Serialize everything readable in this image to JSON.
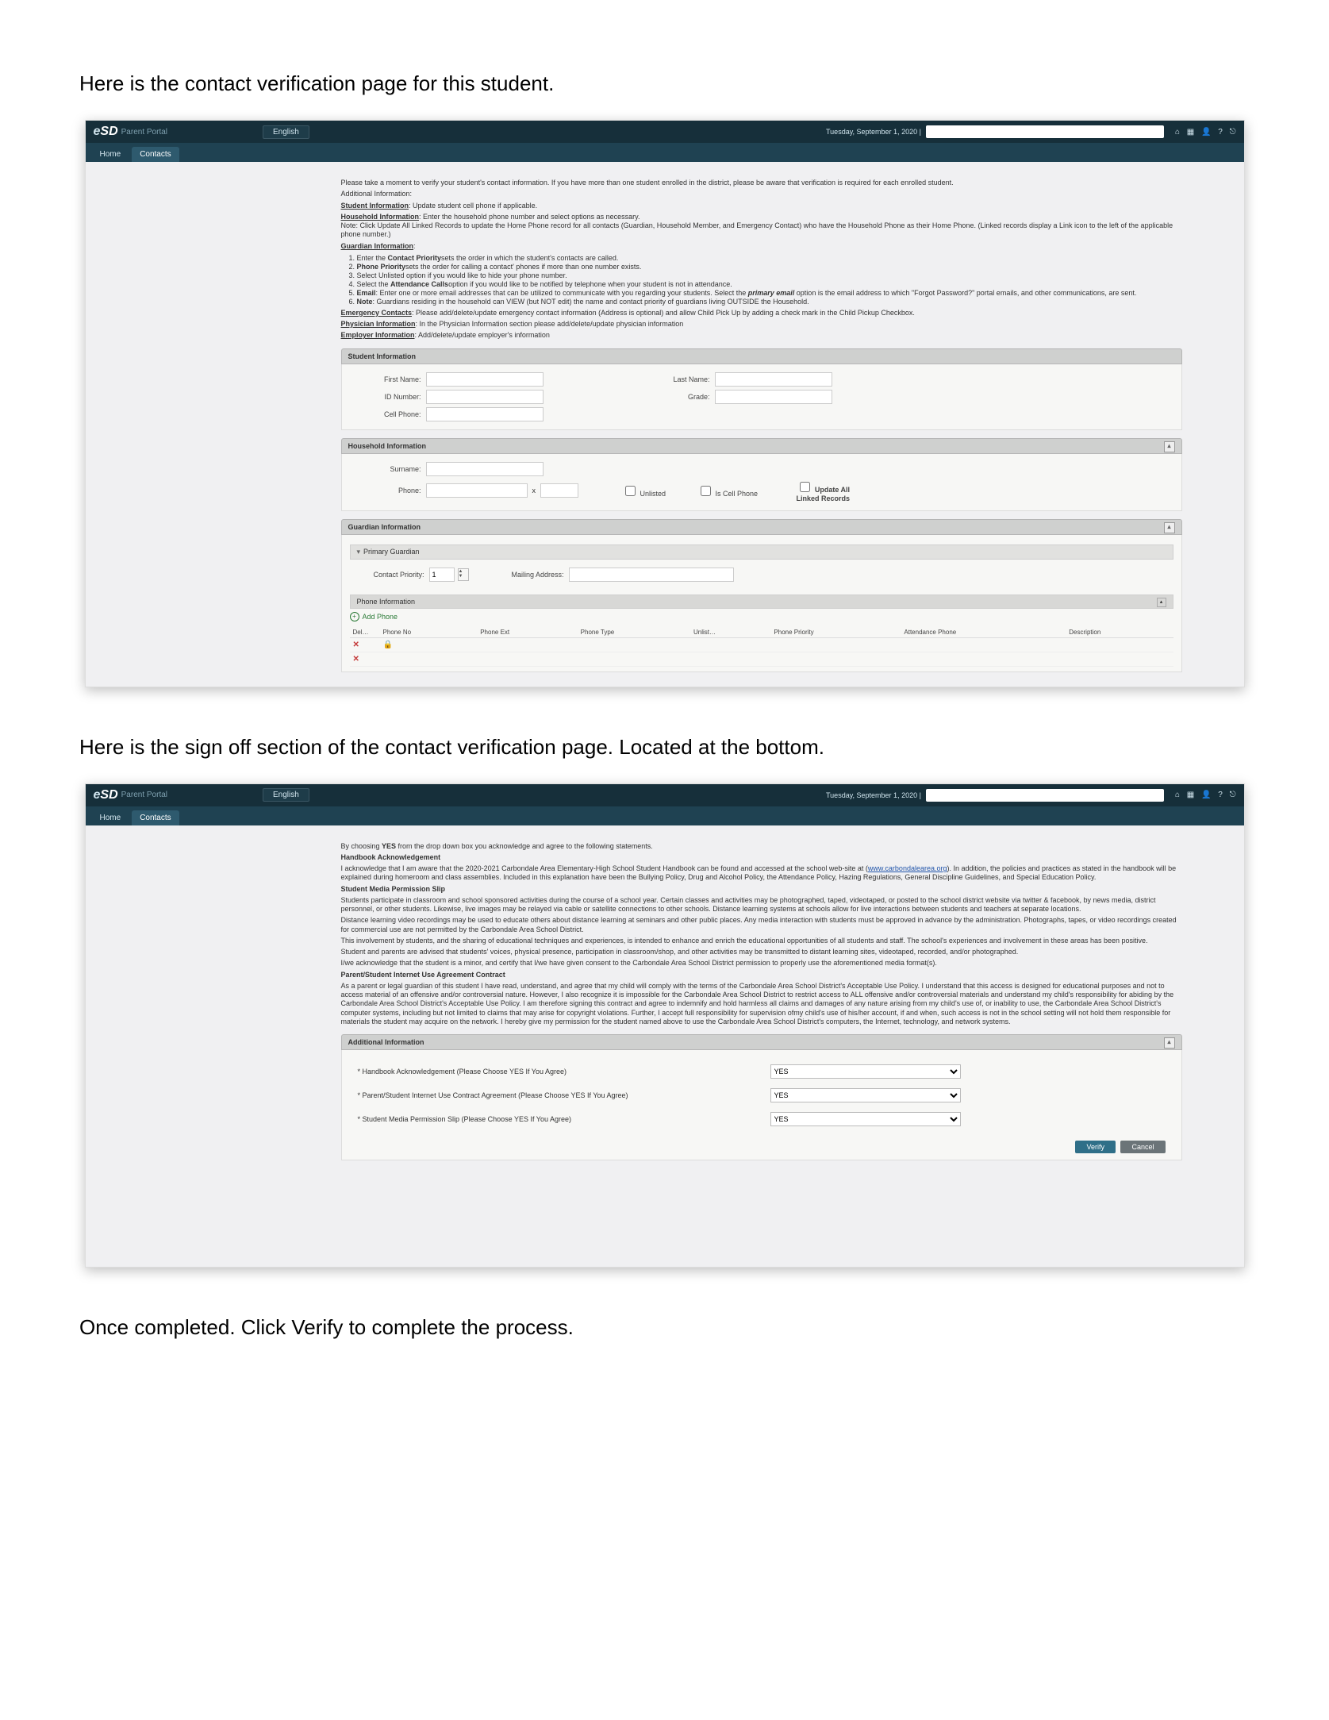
{
  "captions": {
    "c1": "Here is the contact verification page for this student.",
    "c2": "Here is the sign off section of the contact verification page. Located at the bottom.",
    "c3": "Once completed. Click Verify to complete the process."
  },
  "portal": {
    "logo_prefix": "e",
    "logo_main": "SD",
    "logo_sub": "Parent Portal",
    "language": "English",
    "date": "Tuesday, September 1, 2020  |",
    "icons": {
      "home": "⌂",
      "grid": "▦",
      "user": "👤",
      "help": "?",
      "logout": "⎋"
    },
    "menu": {
      "home": "Home",
      "contacts": "Contacts"
    }
  },
  "top": {
    "intro": "Please take a moment to verify your student's contact information.  If you have more than one student enrolled in the district, please be aware that verification is required for each enrolled student.",
    "additional": "Additional Information:",
    "student_info_label": "Student Information",
    "student_info_text": ": Update student cell phone if applicable.",
    "household_label": "Household Information",
    "household_text": ":  Enter the household phone number and select options as necessary.",
    "household_note": "Note:  Click Update All Linked Records to update the Home Phone record for all contacts (Guardian, Household Member, and Emergency Contact) who have the Household Phone as their Home Phone. (Linked records display a Link icon to the left of the applicable phone number.)",
    "guardian_label": "Guardian Information",
    "ordered": {
      "i1_a": "Enter the ",
      "i1_b": "Contact Priority",
      "i1_c": "sets the order in which the student's contacts are called.",
      "i2_a": "Phone Priority",
      "i2_b": "sets the order for calling a contact' phones if more than one number exists.",
      "i3": "Select Unlisted option if you would like to hide your phone number.",
      "i4_a": "Select the ",
      "i4_b": "Attendance Calls",
      "i4_c": "option if you would like to be notified by telephone when your student is not in attendance.",
      "i5_a": "Email",
      "i5_b": ": Enter one or more email addresses that can be utilized to communicate with you regarding your students.  Select the ",
      "i5_c": "primary email",
      "i5_d": " option is the email address to which \"Forgot Password?\" portal emails, and other communications, are sent.",
      "i6_a": "Note",
      "i6_b": ": Guardians residing in the household can VIEW (but NOT edit) the name and contact priority of guardians living OUTSIDE the Household."
    },
    "emergency_label": "Emergency Contacts",
    "emergency_text": ":  Please add/delete/update emergency contact information (Address is optional) and allow Child Pick Up by adding a check mark in the Child Pickup Checkbox.",
    "physician_label": "Physician Information",
    "physician_text": ": In the Physician Information section please add/delete/update physician information",
    "employer_label": "Employer Information",
    "employer_text": ": Add/delete/update employer's information"
  },
  "panels": {
    "student": {
      "title": "Student Information",
      "first": "First Name:",
      "last": "Last Name:",
      "id": "ID Number:",
      "grade": "Grade:",
      "cell": "Cell Phone:"
    },
    "household": {
      "title": "Household Information",
      "surname": "Surname:",
      "phone": "Phone:",
      "x": "x",
      "unlisted": "Unlisted",
      "iscell": "Is Cell Phone",
      "updateall": "Update All Linked Records"
    },
    "guardian": {
      "title": "Guardian Information",
      "primary": "Primary Guardian",
      "contact_priority": "Contact Priority:",
      "priority_val": "1",
      "mailing": "Mailing Address:",
      "phone_info": "Phone Information",
      "add_phone": "Add Phone",
      "cols": {
        "del": "Del…",
        "phone": "Phone No",
        "ext": "Phone Ext",
        "type": "Phone Type",
        "unlist": "Unlist…",
        "pp": "Phone Priority",
        "att": "Attendance Phone",
        "desc": "Description"
      }
    }
  },
  "agree": {
    "intro": "By choosing YES from the drop down box you acknowledge and agree to the following statements.",
    "handbook_title": "Handbook Acknowledgement",
    "handbook_p1a": "I acknowledge that I am aware that the 2020-2021 Carbondale Area Elementary-High School Student Handbook can be found and accessed at the school web-site at (",
    "handbook_link": "www.carbondalearea.org",
    "handbook_p1b": "). In addition, the policies and practices as stated in the handbook will be explained during homeroom and class assemblies. Included in this explanation have been the Bullying Policy, Drug and Alcohol Policy, the Attendance Policy, Hazing Regulations, General Discipline Guidelines, and Special Education Policy.",
    "media_title": "Student Media Permission Slip",
    "media_p1": "Students participate in classroom and school sponsored activities during the course of a school year. Certain classes and activities may be photographed, taped, videotaped, or posted to the school district website via twitter & facebook, by news media, district personnel, or other students. Likewise, live images may be relayed via cable or satellite connections to other schools. Distance learning systems at schools allow for live interactions between students and teachers at separate locations.",
    "media_p2": "Distance learning video recordings may be used to educate others about distance learning at seminars and other public places. Any media interaction with students must be approved in advance by the administration. Photographs, tapes, or video recordings created for commercial use are not permitted by the Carbondale Area School District.",
    "media_p3": "This involvement by students, and the sharing of educational techniques and experiences, is intended to enhance and enrich the educational opportunities of all students and staff. The school's experiences and involvement in these areas has been positive.",
    "media_p4": "Student and parents are advised that students' voices, physical presence, participation in classroom/shop, and other activities may be transmitted to distant learning sites, videotaped, recorded, and/or photographed.",
    "media_p5": "I/we acknowledge that the student is a minor, and certify that I/we have given consent to the Carbondale Area School District permission to properly use the aforementioned media format(s).",
    "internet_title": "Parent/Student Internet Use Agreement Contract",
    "internet_p1": "As a parent or legal guardian of this student I have read, understand, and agree that my child will comply with the terms of the Carbondale Area School District's Acceptable Use Policy. I understand that this access is designed for educational purposes and not to access material of an offensive and/or controversial nature. However, I also recognize it is impossible for the Carbondale Area School District to restrict access to ALL offensive and/or controversial materials and understand my child's responsibility for abiding by the Carbondale Area School District's Acceptable Use Policy. I am therefore signing this contract and agree to indemnify and hold harmless all claims and damages of any nature arising from my child's use of, or inability to use, the Carbondale Area School District's computer systems, including but not limited to claims that may arise for copyright violations. Further, I accept full responsibility for supervision ofmy child's use of his/her account, if and when, such access is not in the school setting will not hold them responsible for materials the student may acquire on the network. I hereby give my permission for the student named above to use the Carbondale Area School District's computers, the Internet, technology, and network systems.",
    "addl_title": "Additional Information",
    "row1": "* Handbook Acknowledgement (Please Choose YES If You Agree)",
    "row2": "* Parent/Student Internet Use Contract Agreement (Please Choose YES If You Agree)",
    "row3": "* Student Media Permission Slip (Please Choose YES If You Agree)",
    "yes": "YES",
    "verify": "Verify",
    "cancel": "Cancel"
  }
}
